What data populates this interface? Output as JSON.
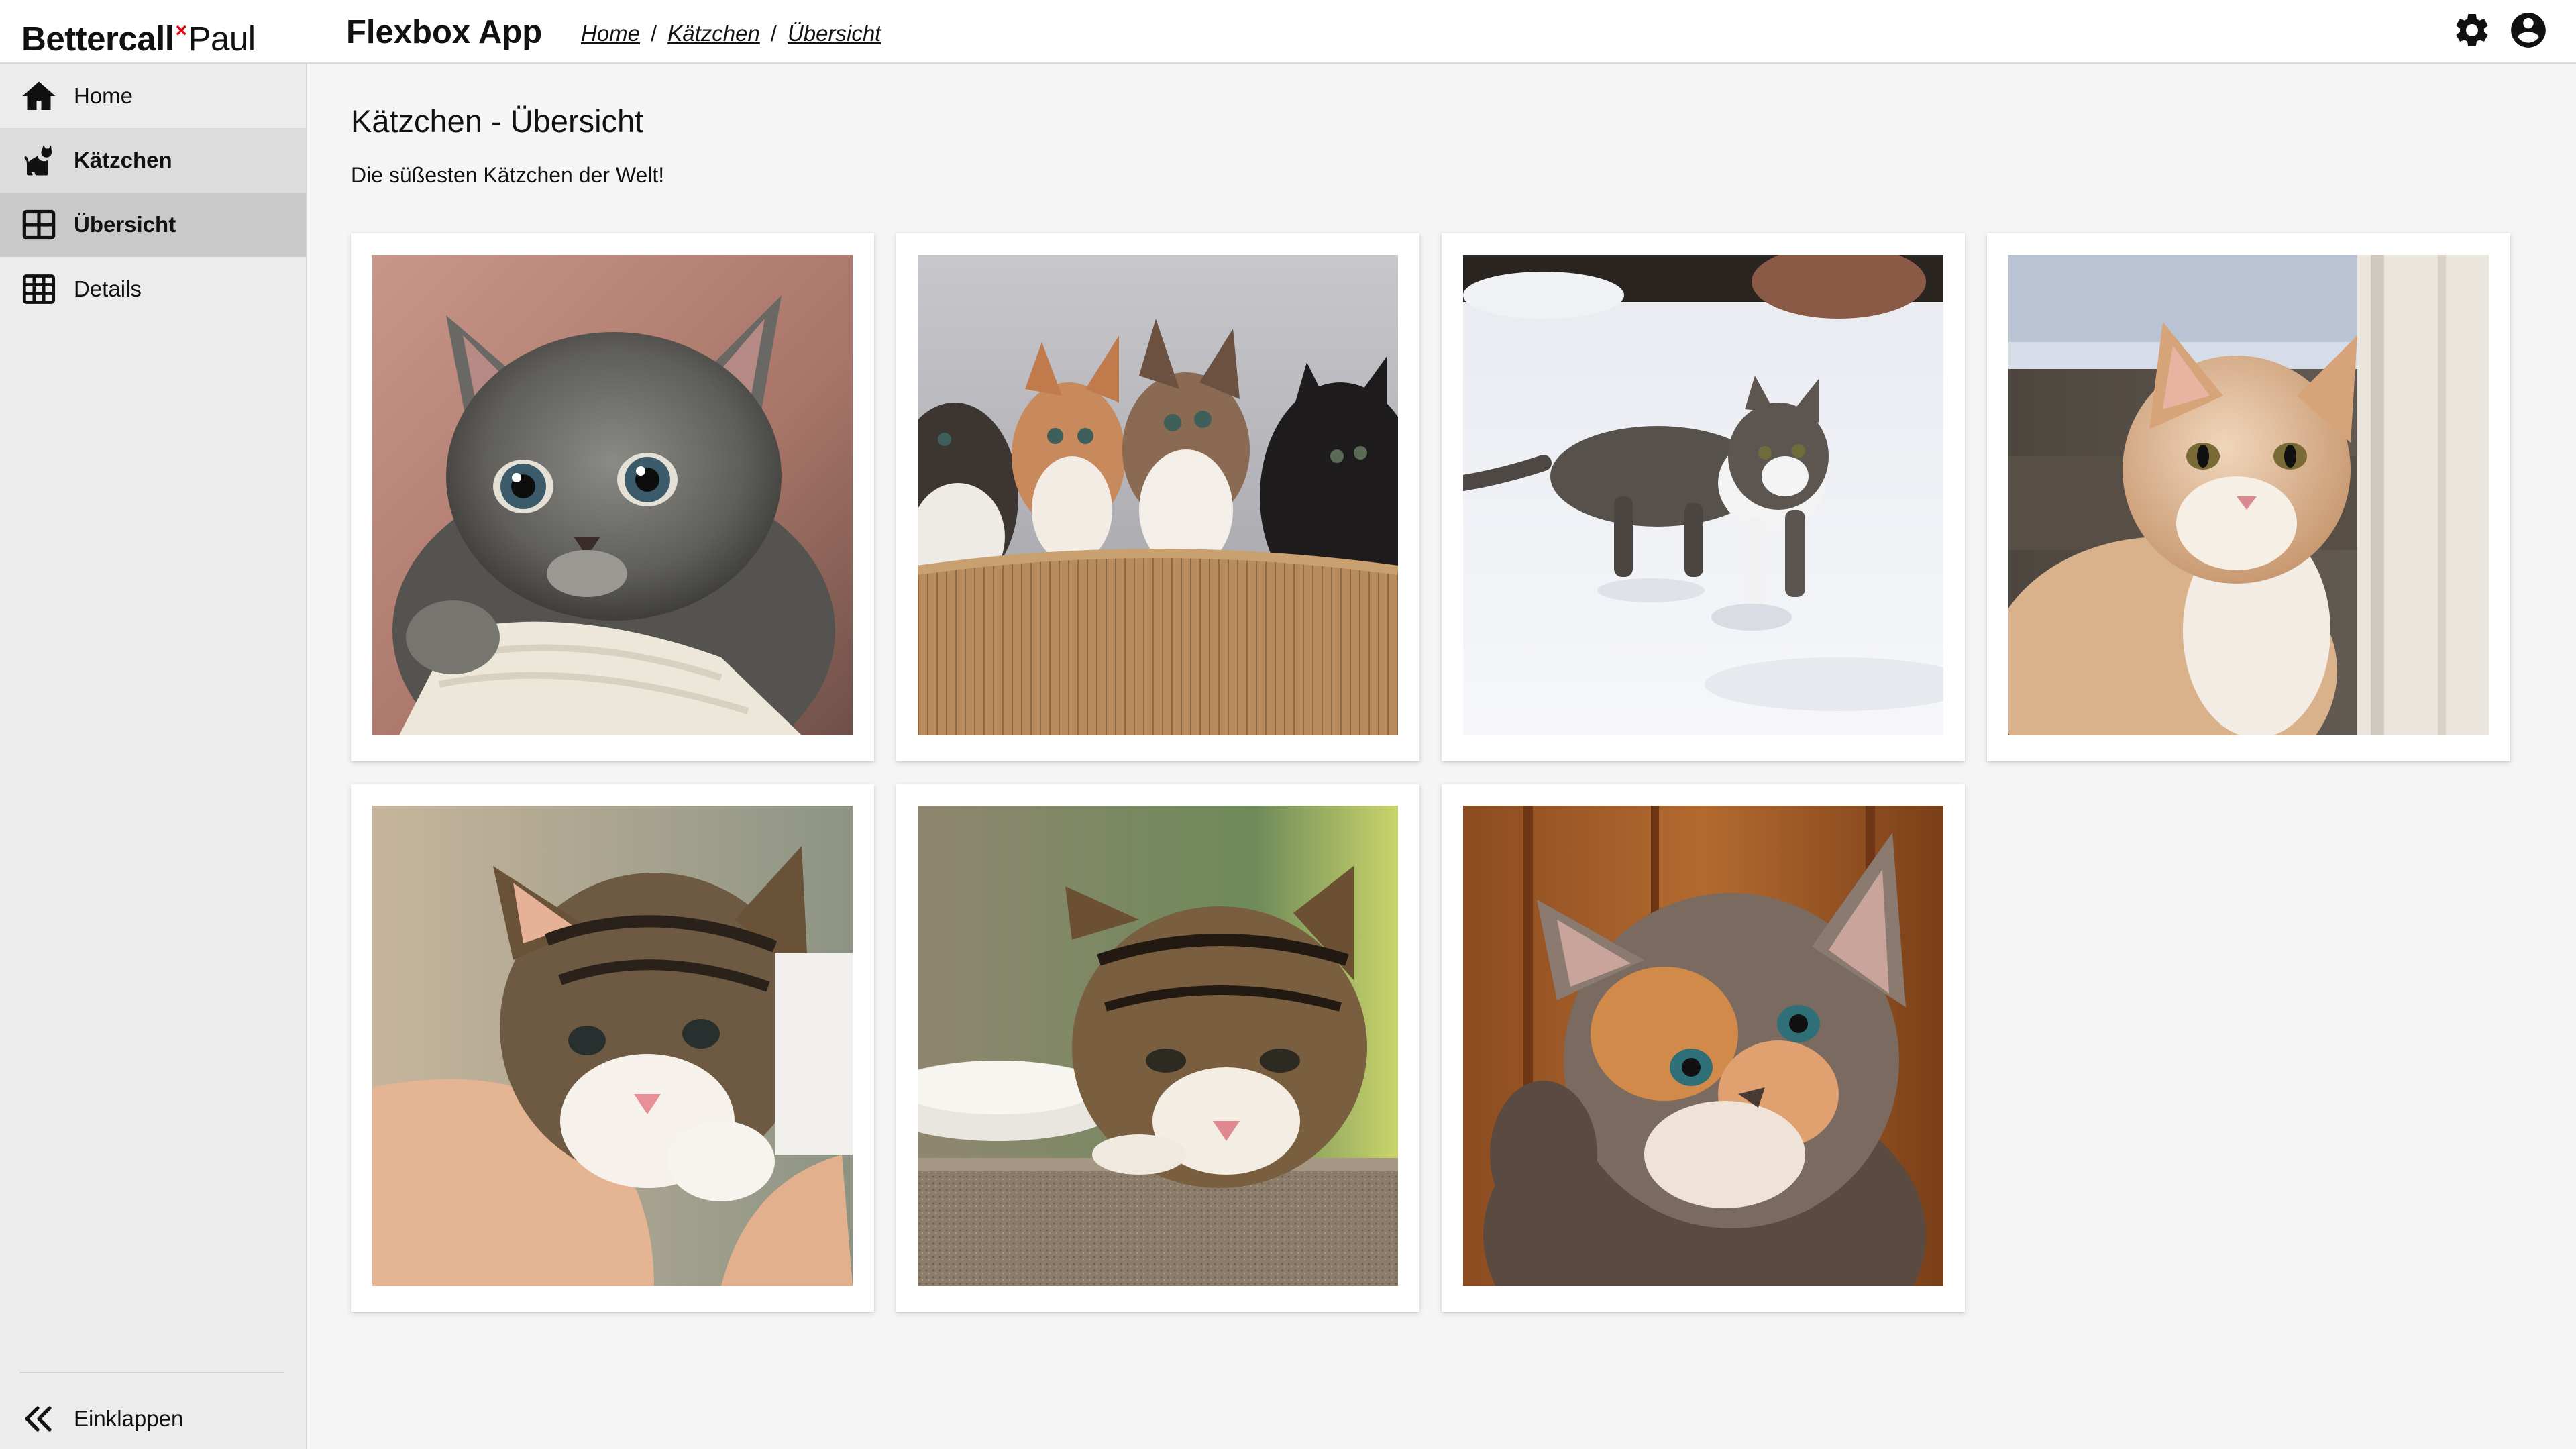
{
  "brand": {
    "bold": "Bettercall",
    "x": "×",
    "regular": "Paul"
  },
  "app": {
    "title": "Flexbox App"
  },
  "breadcrumb": {
    "items": [
      {
        "label": "Home"
      },
      {
        "label": "Kätzchen"
      },
      {
        "label": "Übersicht"
      }
    ],
    "separator": "/"
  },
  "header_icons": [
    "gear-icon",
    "account-circle-icon"
  ],
  "sidebar": {
    "items": [
      {
        "label": "Home",
        "icon": "home-icon"
      },
      {
        "label": "Kätzchen",
        "icon": "cat-icon"
      },
      {
        "label": "Übersicht",
        "icon": "grid-view-icon"
      },
      {
        "label": "Details",
        "icon": "table-icon"
      }
    ],
    "collapse": {
      "label": "Einklappen",
      "icon": "double-chevron-left-icon"
    }
  },
  "page": {
    "title": "Kätzchen - Übersicht",
    "subtitle": "Die süßesten Kätzchen der Welt!"
  },
  "colors": {
    "header_bg": "#ffffff",
    "sidebar_bg": "#ececec",
    "sidebar_parent_active": "#dcdcdc",
    "sidebar_active": "#c9c9c9",
    "content_bg": "#f5f5f5",
    "brand_accent": "#e3000f"
  }
}
